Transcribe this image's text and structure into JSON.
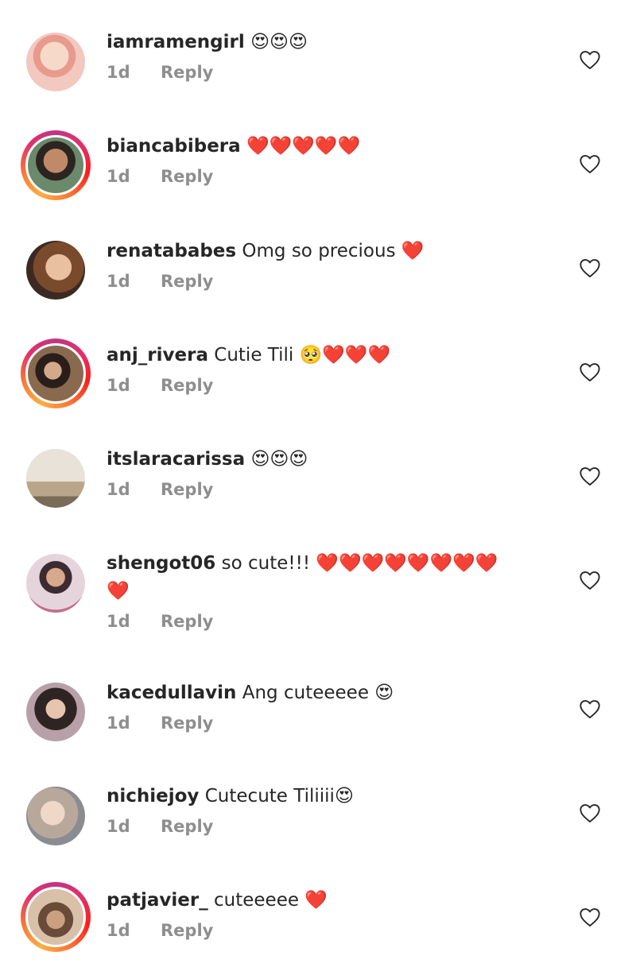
{
  "comments": [
    {
      "username": "iamramengirl",
      "text": "😍😍😍",
      "time": "1d",
      "reply": "Reply"
    },
    {
      "username": "biancabibera",
      "text": "❤️❤️❤️❤️❤️",
      "time": "1d",
      "reply": "Reply"
    },
    {
      "username": "renatababes",
      "text": "Omg so precious ❤️",
      "time": "1d",
      "reply": "Reply"
    },
    {
      "username": "anj_rivera",
      "text": "Cutie Tili 🥺❤️❤️❤️",
      "time": "1d",
      "reply": "Reply"
    },
    {
      "username": "itslaracarissa",
      "text": "😍😍😍",
      "time": "1d",
      "reply": "Reply"
    },
    {
      "username": "shengot06",
      "text": "so cute!!! ❤️❤️❤️❤️❤️❤️❤️❤️",
      "text_line2": "❤️",
      "time": "1d",
      "reply": "Reply"
    },
    {
      "username": "kacedullavin",
      "text": "Ang cuteeeee 😍",
      "time": "1d",
      "reply": "Reply"
    },
    {
      "username": "nichiejoy",
      "text": "Cutecute Tiliiii😍",
      "time": "1d",
      "reply": "Reply"
    },
    {
      "username": "patjavier_",
      "text": "cuteeeee ❤️",
      "time": "1d",
      "reply": "Reply"
    }
  ],
  "icons": {
    "like": "heart-outline-icon"
  },
  "colors": {
    "text": "#262626",
    "secondary": "#8e8e8e",
    "story_ring_start": "#c13584",
    "story_ring_end": "#fcaf45"
  }
}
